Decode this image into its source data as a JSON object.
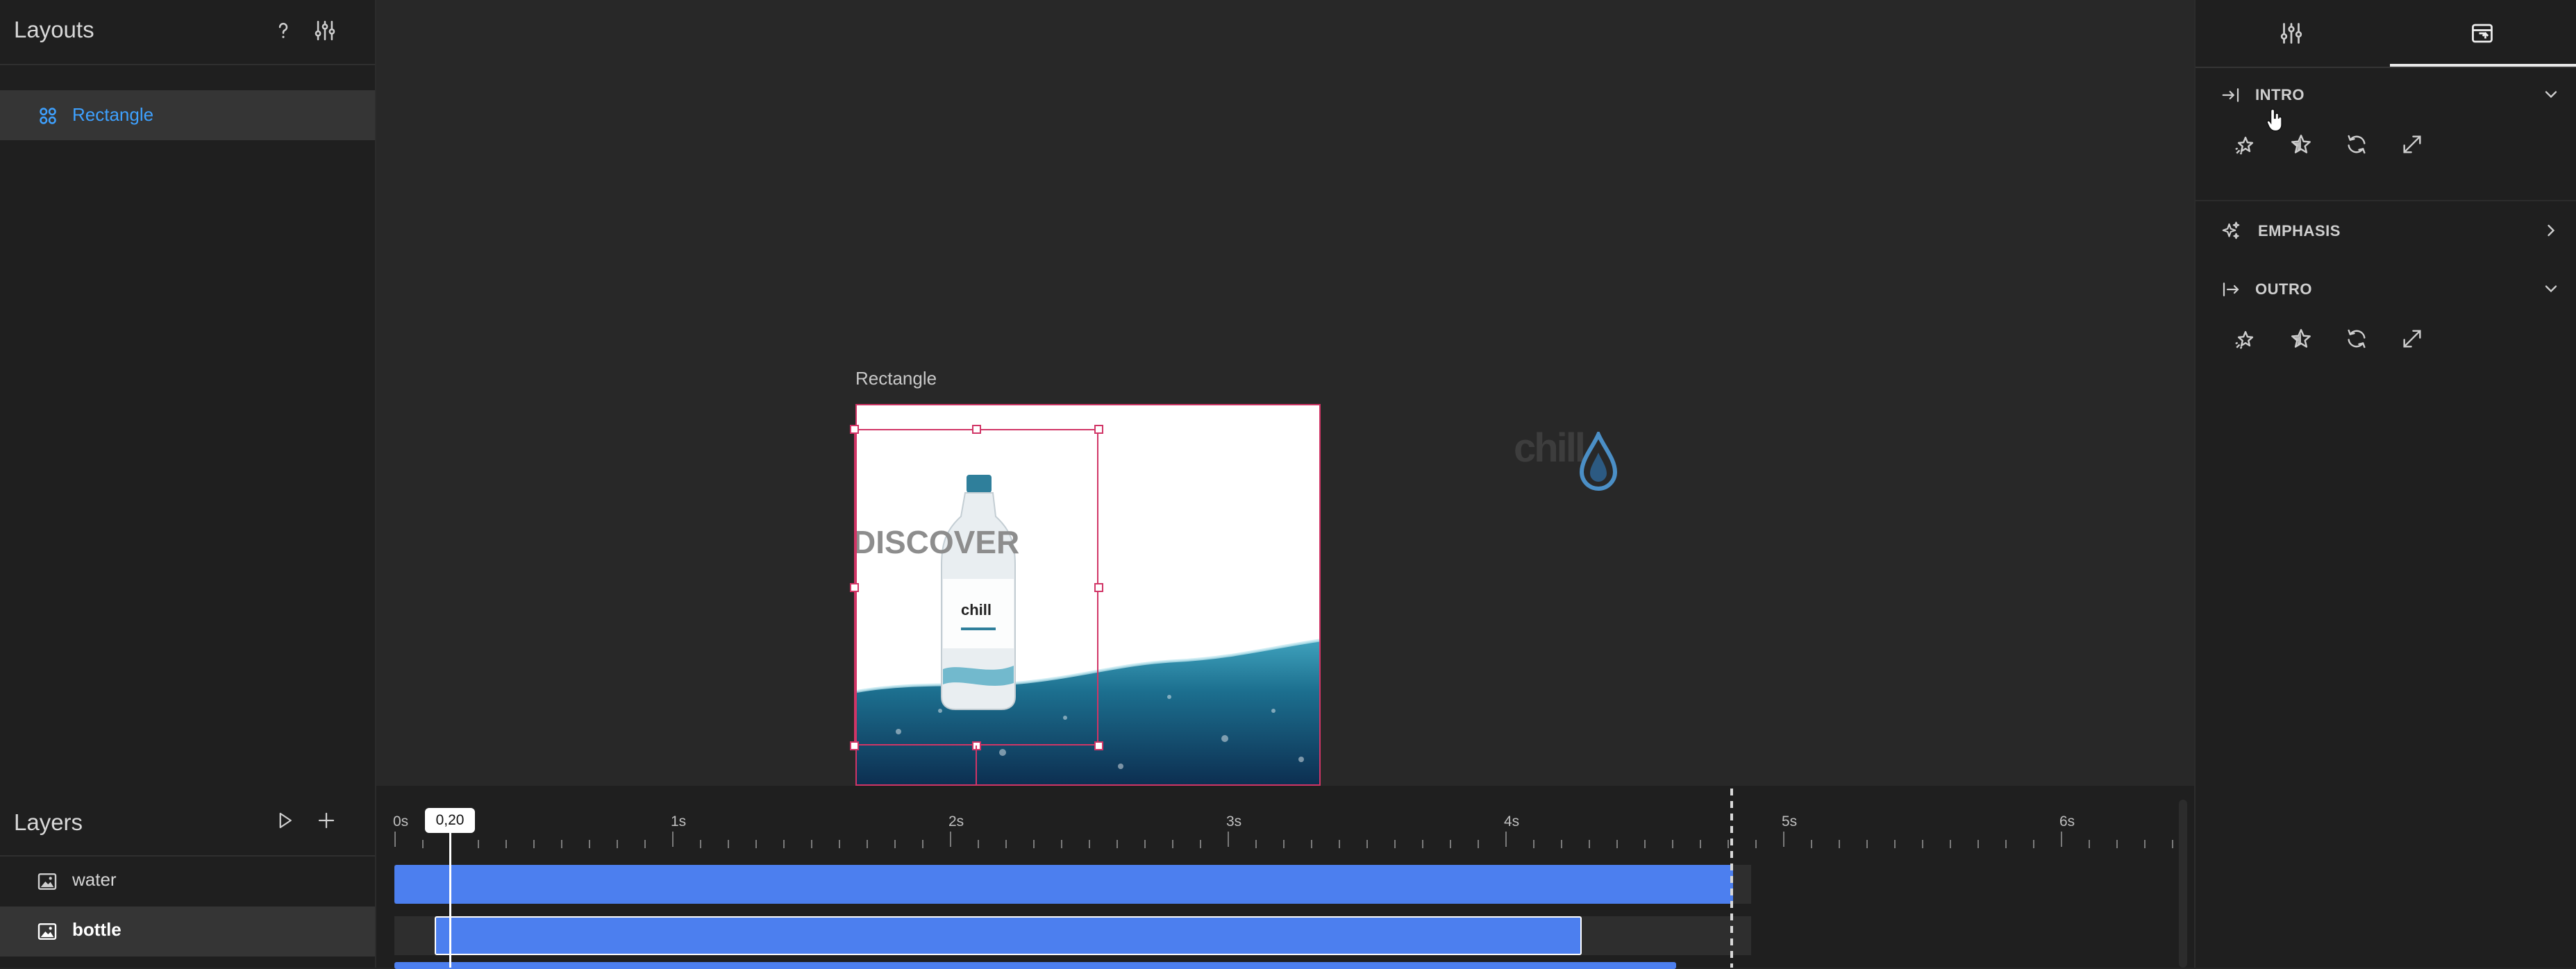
{
  "layouts_panel": {
    "title": "Layouts",
    "help_icon": "question-icon",
    "settings_icon": "sliders-icon",
    "items": [
      {
        "label": "Rectangle",
        "icon": "layout-grid-icon",
        "selected": true
      }
    ]
  },
  "canvas": {
    "artboard_label": "Rectangle",
    "headline": "DISCOVER",
    "brand_mark_text": "chill",
    "accent_color": "#d13566"
  },
  "inspector": {
    "tabs": [
      {
        "icon": "sliders-icon",
        "active": false
      },
      {
        "icon": "animation-panel-icon",
        "active": true
      }
    ],
    "sections": [
      {
        "title": "INTRO",
        "icon": "arrow-into-bar-icon",
        "expanded": true,
        "buttons": [
          "sparkle-star-icon",
          "star-icon",
          "refresh-icon",
          "expand-icon"
        ]
      },
      {
        "title": "EMPHASIS",
        "icon": "sparkles-icon",
        "expanded": false,
        "buttons": []
      },
      {
        "title": "OUTRO",
        "icon": "arrow-out-bar-icon",
        "expanded": true,
        "buttons": [
          "sparkle-star-icon",
          "star-icon",
          "refresh-icon",
          "expand-icon"
        ]
      }
    ]
  },
  "layers_panel": {
    "title": "Layers",
    "play_icon": "play-icon",
    "add_icon": "plus-icon",
    "layers": [
      {
        "name": "water",
        "icon": "image-icon",
        "selected": false
      },
      {
        "name": "bottle",
        "icon": "image-icon",
        "selected": true
      }
    ]
  },
  "timeline": {
    "playhead_label": "0,20",
    "playhead_seconds": 0.2,
    "end_seconds": 4.8,
    "ruler_labels": [
      "0s",
      "1s",
      "2s",
      "3s",
      "4s",
      "5s",
      "6s"
    ],
    "clip_color": "#4c7fef"
  }
}
